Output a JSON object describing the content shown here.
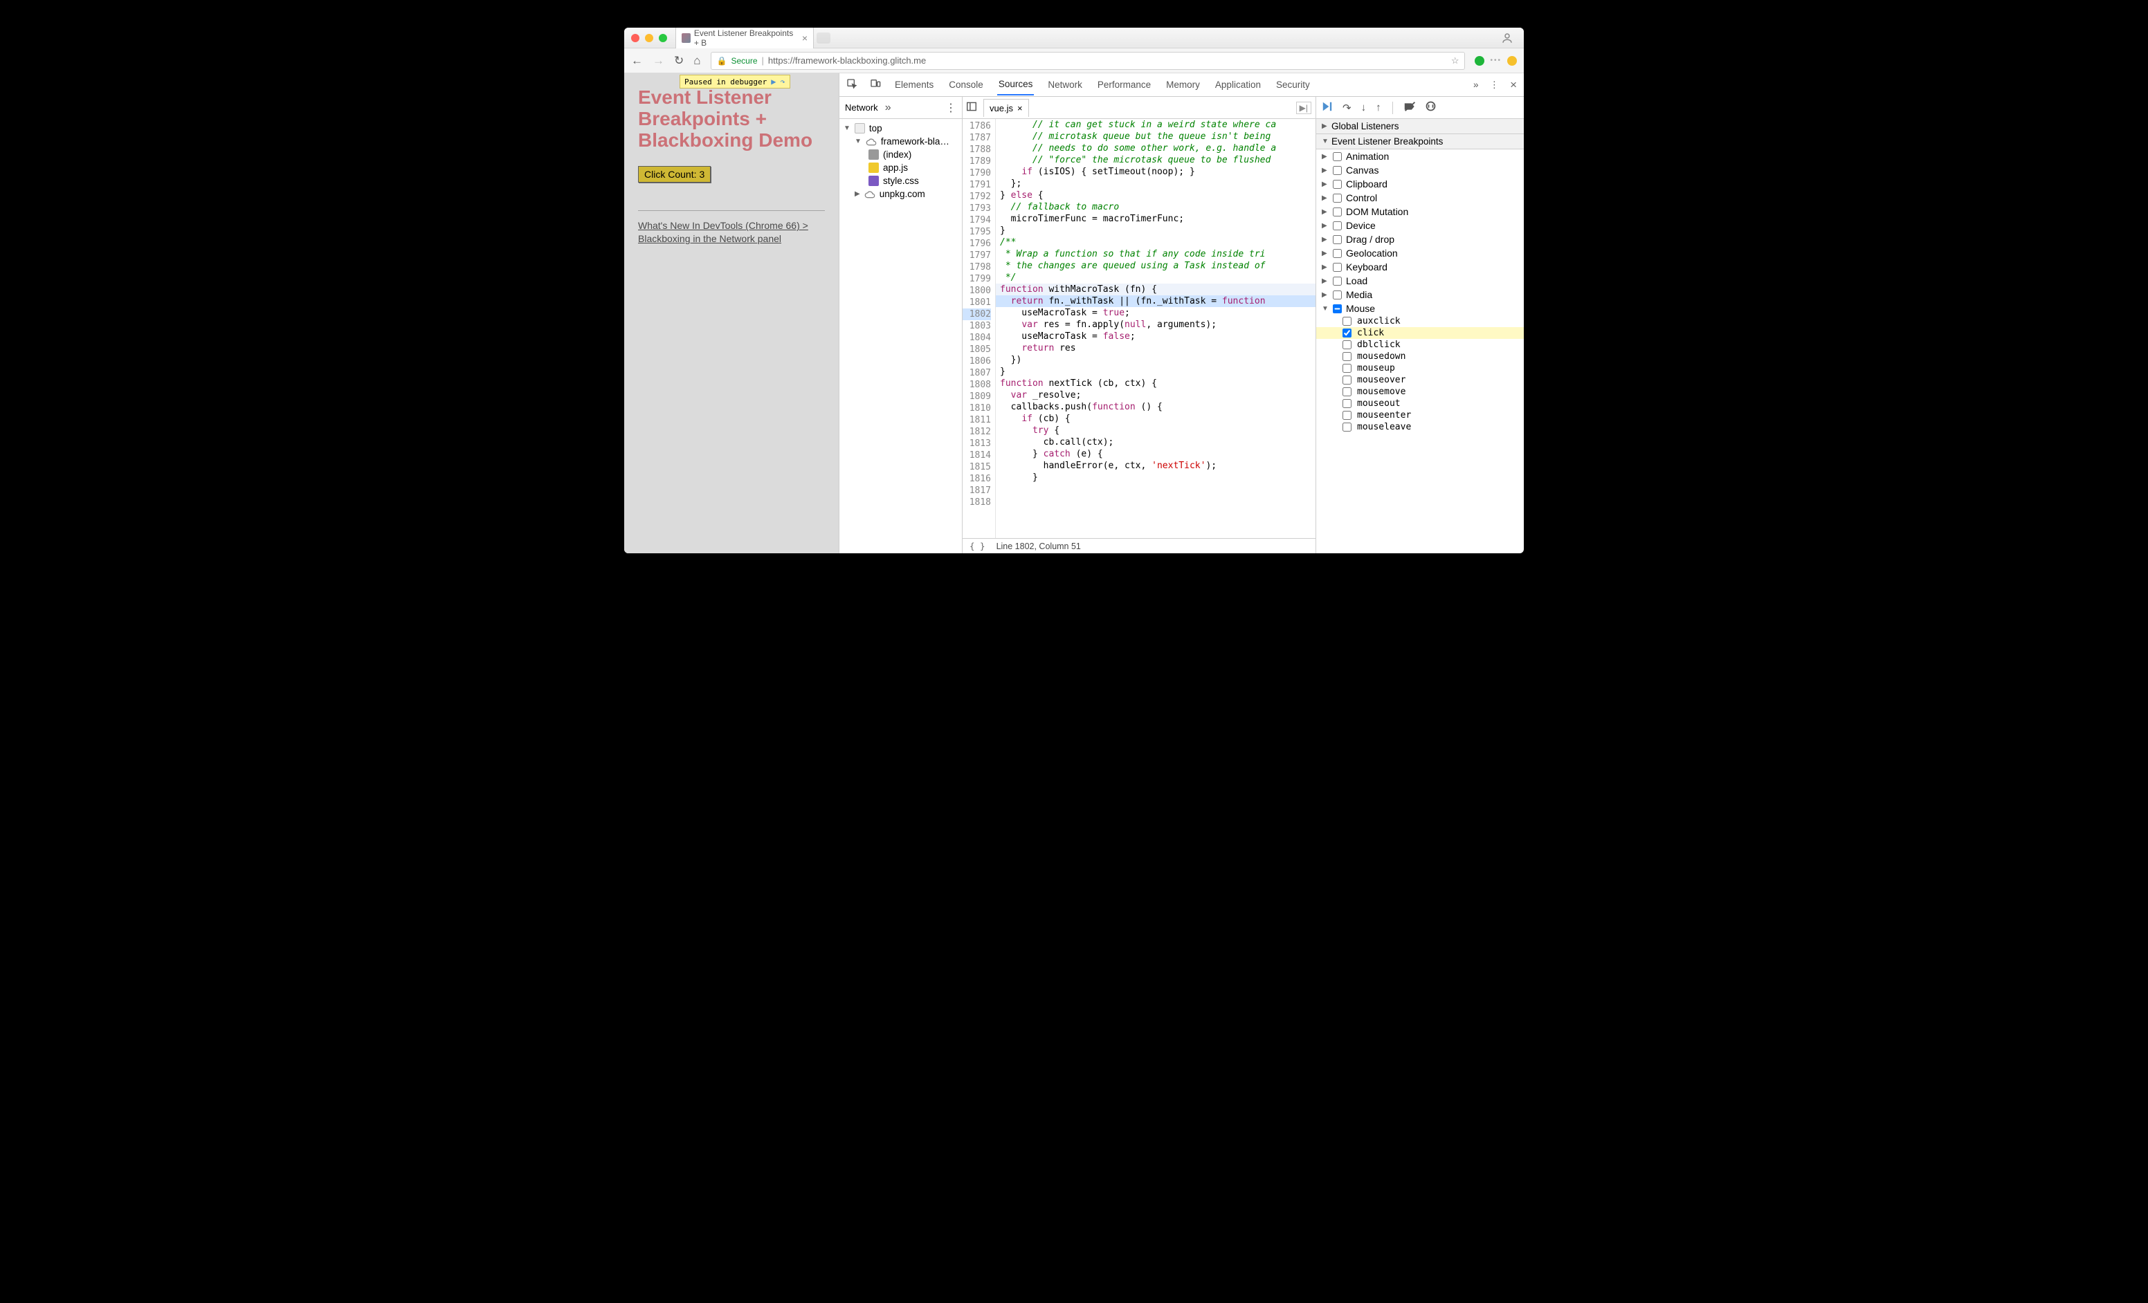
{
  "window": {
    "tab_title": "Event Listener Breakpoints + B",
    "user_icon": "user"
  },
  "toolbar": {
    "secure_label": "Secure",
    "url_host": "https://framework-blackboxing.glitch.me",
    "url_path": ""
  },
  "page": {
    "paused_label": "Paused in debugger",
    "heading": "Event Listener Breakpoints + Blackboxing Demo",
    "button_label": "Click Count:",
    "button_count": "3",
    "blog_link": "What's New In DevTools (Chrome 66) > Blackboxing in the Network panel"
  },
  "devtools": {
    "tabs": [
      "Elements",
      "Console",
      "Sources",
      "Network",
      "Performance",
      "Memory",
      "Application",
      "Security"
    ],
    "active_tab": "Sources"
  },
  "navigator": {
    "head_label": "Network",
    "tree": {
      "top": "top",
      "domain1": "framework-bla…",
      "files": [
        "(index)",
        "app.js",
        "style.css"
      ],
      "domain2": "unpkg.com"
    }
  },
  "editor": {
    "tab_name": "vue.js",
    "status_line": "Line 1802, Column 51",
    "first_line": 1786,
    "lines": [
      "      // it can get stuck in a weird state where ca",
      "      // microtask queue but the queue isn't being ",
      "      // needs to do some other work, e.g. handle a",
      "      // \"force\" the microtask queue to be flushed",
      "    if (isIOS) { setTimeout(noop); }",
      "  };",
      "} else {",
      "  // fallback to macro",
      "  microTimerFunc = macroTimerFunc;",
      "}",
      "",
      "/**",
      " * Wrap a function so that if any code inside tri",
      " * the changes are queued using a Task instead of",
      " */",
      "function withMacroTask (fn) {",
      "  return fn._withTask || (fn._withTask = function",
      "    useMacroTask = true;",
      "    var res = fn.apply(null, arguments);",
      "    useMacroTask = false;",
      "    return res",
      "  })",
      "} ",
      "",
      "function nextTick (cb, ctx) {",
      "  var _resolve;",
      "  callbacks.push(function () {",
      "    if (cb) {",
      "      try {",
      "        cb.call(ctx);",
      "      } catch (e) {",
      "        handleError(e, ctx, 'nextTick');",
      "      }"
    ],
    "func_line": 1801,
    "exec_line": 1802
  },
  "sidebar": {
    "global_listeners": "Global Listeners",
    "elb_title": "Event Listener Breakpoints",
    "categories": [
      "Animation",
      "Canvas",
      "Clipboard",
      "Control",
      "DOM Mutation",
      "Device",
      "Drag / drop",
      "Geolocation",
      "Keyboard",
      "Load",
      "Media",
      "Mouse"
    ],
    "expanded": "Mouse",
    "mouse_events": [
      "auxclick",
      "click",
      "dblclick",
      "mousedown",
      "mouseup",
      "mouseover",
      "mousemove",
      "mouseout",
      "mouseenter",
      "mouseleave"
    ],
    "checked_event": "click"
  }
}
